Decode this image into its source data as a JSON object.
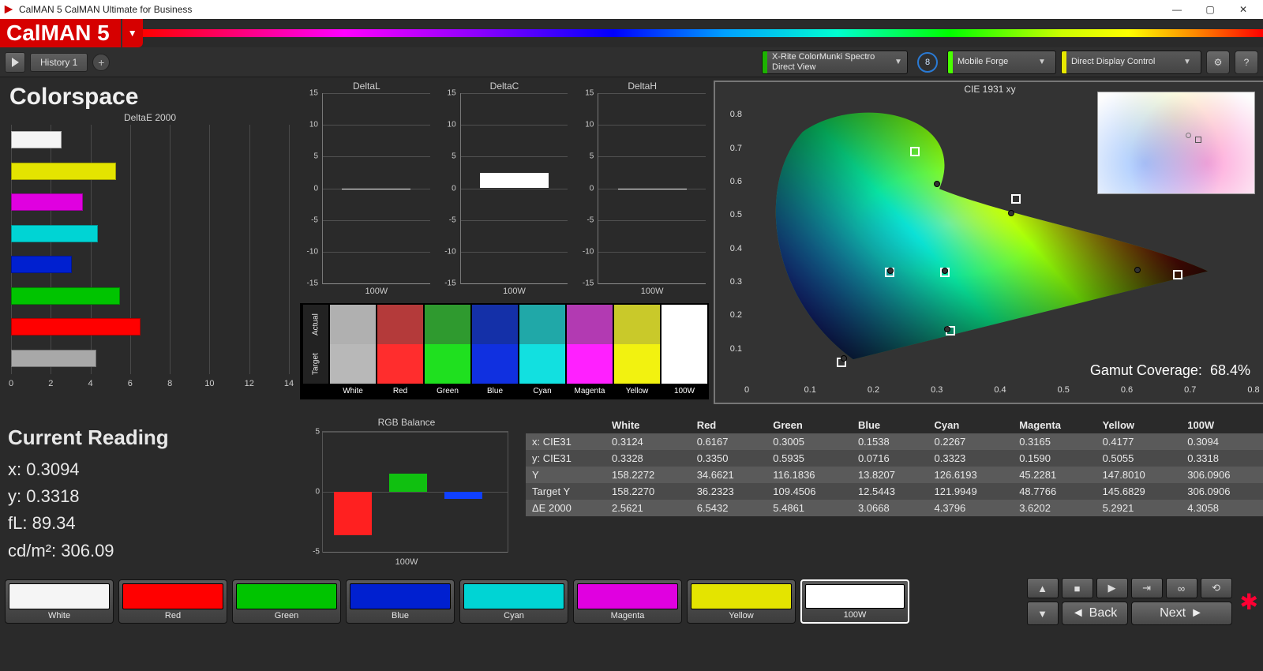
{
  "window": {
    "title": "CalMAN 5 CalMAN Ultimate for Business"
  },
  "brand": {
    "logo_text": "CalMAN 5"
  },
  "toolbar": {
    "history_tab": "History 1",
    "meter": {
      "line1": "X-Rite ColorMunki Spectro",
      "line2": "Direct View"
    },
    "meter_badge": "8",
    "source": "Mobile Forge",
    "display": "Direct Display Control"
  },
  "page": {
    "title": "Colorspace",
    "cie_title": "CIE 1931 xy",
    "gamut_coverage_label": "Gamut Coverage:",
    "gamut_coverage_value": "68.4%"
  },
  "current_reading": {
    "heading": "Current Reading",
    "x_label": "x:",
    "x_value": "0.3094",
    "y_label": "y:",
    "y_value": "0.3318",
    "fl_label": "fL:",
    "fl_value": "89.34",
    "cdm2_label": "cd/m²:",
    "cdm2_value": "306.09"
  },
  "swatches": [
    {
      "name": "White",
      "hex": "#f5f5f5",
      "actual": "#b0b0b0",
      "target": "#b8b8b8"
    },
    {
      "name": "Red",
      "hex": "#ff0000",
      "actual": "#b43a3a",
      "target": "#ff2d2d"
    },
    {
      "name": "Green",
      "hex": "#00c400",
      "actual": "#2f9a2f",
      "target": "#1fe01f"
    },
    {
      "name": "Blue",
      "hex": "#0020d0",
      "actual": "#1430a8",
      "target": "#1030e0"
    },
    {
      "name": "Cyan",
      "hex": "#00d4d4",
      "actual": "#20a8a8",
      "target": "#12e0e0"
    },
    {
      "name": "Magenta",
      "hex": "#e000e0",
      "actual": "#b23ab2",
      "target": "#ff20ff"
    },
    {
      "name": "Yellow",
      "hex": "#e4e400",
      "actual": "#c9c92a",
      "target": "#f2f210"
    },
    {
      "name": "100W",
      "hex": "#ffffff",
      "actual": "#ffffff",
      "target": "#ffffff"
    }
  ],
  "swatch_side_labels": {
    "actual": "Actual",
    "target": "Target"
  },
  "table": {
    "headers": [
      "",
      "White",
      "Red",
      "Green",
      "Blue",
      "Cyan",
      "Magenta",
      "Yellow",
      "100W"
    ],
    "rows": [
      {
        "label": "x: CIE31",
        "cells": [
          "0.3124",
          "0.6167",
          "0.3005",
          "0.1538",
          "0.2267",
          "0.3165",
          "0.4177",
          "0.3094"
        ]
      },
      {
        "label": "y: CIE31",
        "cells": [
          "0.3328",
          "0.3350",
          "0.5935",
          "0.0716",
          "0.3323",
          "0.1590",
          "0.5055",
          "0.3318"
        ]
      },
      {
        "label": "Y",
        "cells": [
          "158.2272",
          "34.6621",
          "116.1836",
          "13.8207",
          "126.6193",
          "45.2281",
          "147.8010",
          "306.0906"
        ]
      },
      {
        "label": "Target Y",
        "cells": [
          "158.2270",
          "36.2323",
          "109.4506",
          "12.5443",
          "121.9949",
          "48.7766",
          "145.6829",
          "306.0906"
        ]
      },
      {
        "label": "ΔE 2000",
        "cells": [
          "2.5621",
          "6.5432",
          "5.4861",
          "3.0668",
          "4.3796",
          "3.6202",
          "5.2921",
          "4.3058"
        ]
      }
    ]
  },
  "nav": {
    "back": "Back",
    "next": "Next"
  },
  "chart_data": [
    {
      "name": "DeltaE 2000",
      "type": "bar",
      "title": "DeltaE 2000",
      "orientation": "horizontal",
      "xlabel": "",
      "ylabel": "",
      "xlim": [
        0,
        14
      ],
      "x_ticks": [
        0,
        2,
        4,
        6,
        8,
        10,
        12,
        14
      ],
      "categories": [
        "White",
        "Yellow",
        "Magenta",
        "Cyan",
        "Blue",
        "Green",
        "Red",
        "100W"
      ],
      "colors": [
        "#f5f5f5",
        "#e4e400",
        "#e000e0",
        "#00d4d4",
        "#0020d0",
        "#00c400",
        "#ff0000",
        "#a8a8a8"
      ],
      "values": [
        2.56,
        5.29,
        3.62,
        4.38,
        3.07,
        5.49,
        6.54,
        4.31
      ]
    },
    {
      "name": "DeltaL",
      "type": "bar",
      "title": "DeltaL",
      "categories": [
        "100W"
      ],
      "values": [
        0.0
      ],
      "ylim": [
        -15,
        15
      ],
      "y_ticks": [
        -15,
        -10,
        -5,
        0,
        5,
        10,
        15
      ],
      "xlabel": "100W"
    },
    {
      "name": "DeltaC",
      "type": "bar",
      "title": "DeltaC",
      "categories": [
        "100W"
      ],
      "values": [
        2.4
      ],
      "ylim": [
        -15,
        15
      ],
      "y_ticks": [
        -15,
        -10,
        -5,
        0,
        5,
        10,
        15
      ],
      "xlabel": "100W"
    },
    {
      "name": "DeltaH",
      "type": "bar",
      "title": "DeltaH",
      "categories": [
        "100W"
      ],
      "values": [
        0.0
      ],
      "ylim": [
        -15,
        15
      ],
      "y_ticks": [
        -15,
        -10,
        -5,
        0,
        5,
        10,
        15
      ],
      "xlabel": "100W"
    },
    {
      "name": "CIE 1931 xy",
      "type": "scatter",
      "title": "CIE 1931 xy",
      "xlabel": "",
      "ylabel": "",
      "xlim": [
        0,
        0.8
      ],
      "ylim": [
        0,
        0.85
      ],
      "x_ticks": [
        0,
        0.1,
        0.2,
        0.3,
        0.4,
        0.5,
        0.6,
        0.7,
        0.8
      ],
      "y_ticks": [
        0.1,
        0.2,
        0.3,
        0.4,
        0.5,
        0.6,
        0.7,
        0.8
      ],
      "series": [
        {
          "name": "target",
          "marker": "square",
          "points": [
            {
              "label": "White",
              "x": 0.3127,
              "y": 0.329
            },
            {
              "label": "Red",
              "x": 0.68,
              "y": 0.32
            },
            {
              "label": "Green",
              "x": 0.265,
              "y": 0.69
            },
            {
              "label": "Blue",
              "x": 0.15,
              "y": 0.06
            },
            {
              "label": "Cyan",
              "x": 0.225,
              "y": 0.329
            },
            {
              "label": "Magenta",
              "x": 0.321,
              "y": 0.154
            },
            {
              "label": "Yellow",
              "x": 0.425,
              "y": 0.547
            }
          ]
        },
        {
          "name": "measured",
          "marker": "circle",
          "points": [
            {
              "label": "White",
              "x": 0.3124,
              "y": 0.3328
            },
            {
              "label": "Red",
              "x": 0.6167,
              "y": 0.335
            },
            {
              "label": "Green",
              "x": 0.3005,
              "y": 0.5935
            },
            {
              "label": "Blue",
              "x": 0.1538,
              "y": 0.0716
            },
            {
              "label": "Cyan",
              "x": 0.2267,
              "y": 0.3323
            },
            {
              "label": "Magenta",
              "x": 0.3165,
              "y": 0.159
            },
            {
              "label": "Yellow",
              "x": 0.4177,
              "y": 0.5055
            }
          ]
        }
      ],
      "annotation": {
        "label": "Gamut Coverage",
        "value": "68.4%"
      }
    },
    {
      "name": "RGB Balance",
      "type": "bar",
      "title": "RGB Balance",
      "categories": [
        "R",
        "G",
        "B"
      ],
      "colors": [
        "#ff2020",
        "#10c010",
        "#1040ff"
      ],
      "values": [
        -3.6,
        1.5,
        -0.6
      ],
      "ylim": [
        -5,
        5
      ],
      "y_ticks": [
        -5,
        0,
        5
      ],
      "xlabel": "100W"
    }
  ]
}
